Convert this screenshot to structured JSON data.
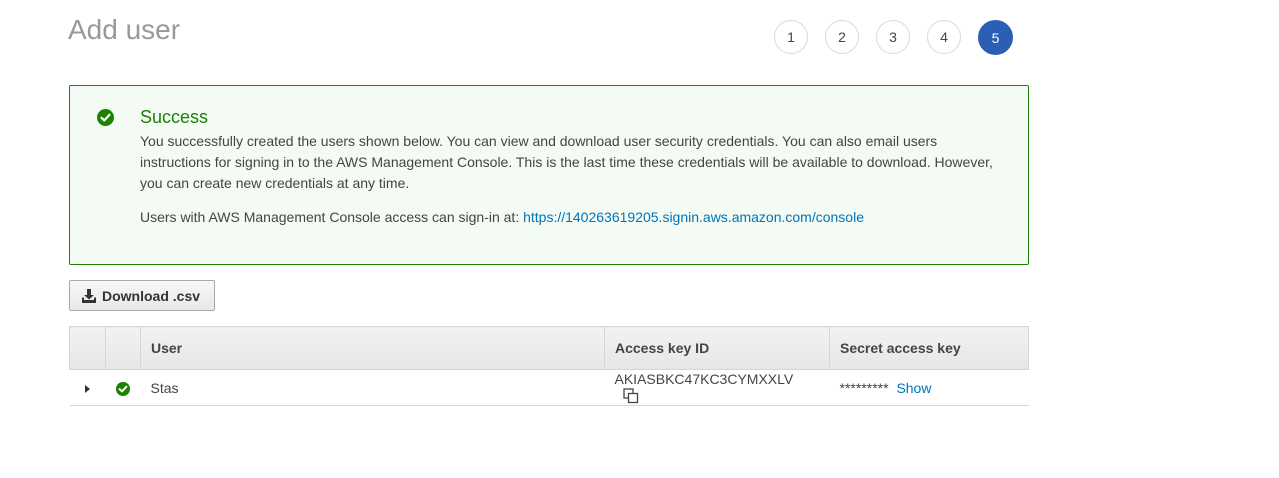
{
  "header": {
    "title": "Add user",
    "steps": [
      "1",
      "2",
      "3",
      "4",
      "5"
    ],
    "active_step": "5"
  },
  "alert": {
    "title": "Success",
    "body": "You successfully created the users shown below. You can view and download user security credentials. You can also email users instructions for signing in to the AWS Management Console. This is the last time these credentials will be available to download. However, you can create new credentials at any time.",
    "signin_text": "Users with AWS Management Console access can sign-in at:",
    "signin_url": "https://140263619205.signin.aws.amazon.com/console",
    "icon": "check-circle-icon",
    "color": "#1d8102"
  },
  "toolbar": {
    "download_label": "Download .csv",
    "download_icon": "download-icon"
  },
  "table": {
    "columns": [
      "",
      "",
      "User",
      "Access key ID",
      "Secret access key"
    ],
    "rows": [
      {
        "user": "Stas",
        "access_key_id": "AKIASBKC47KC3CYMXXLV",
        "secret_masked": "*********",
        "show_label": "Show"
      }
    ]
  },
  "colors": {
    "accent": "#2a5fb4",
    "link": "#0073bb",
    "success": "#1d8102"
  }
}
